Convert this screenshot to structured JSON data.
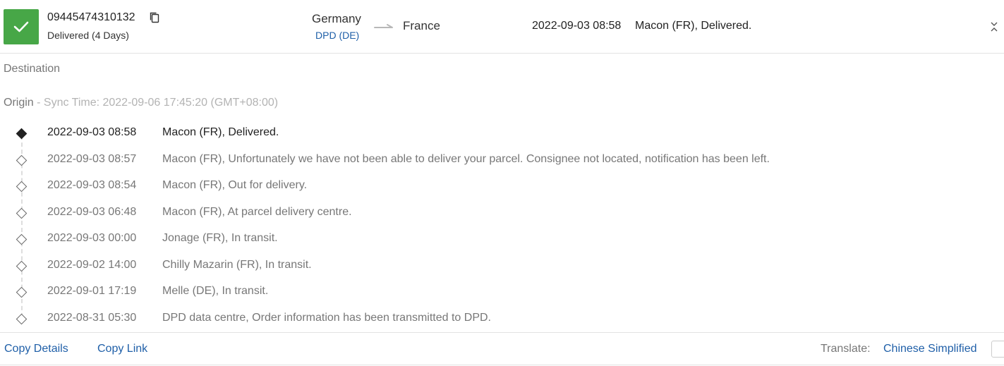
{
  "header": {
    "tracking_number": "09445474310132",
    "status": "Delivered (4 Days)",
    "origin_country": "Germany",
    "carrier": "DPD (DE)",
    "destination_country": "France",
    "latest_event_time": "2022-09-03 08:58",
    "latest_event_desc": "Macon (FR), Delivered.",
    "status_color": "#47a747"
  },
  "sections": {
    "destination_label": "Destination",
    "origin_label": "Origin",
    "sync_text": " - Sync Time: 2022-09-06 17:45:20 (GMT+08:00)"
  },
  "events": [
    {
      "time": "2022-09-03 08:58",
      "desc": "Macon (FR), Delivered."
    },
    {
      "time": "2022-09-03 08:57",
      "desc": "Macon (FR), Unfortunately we have not been able to deliver your parcel. Consignee not located, notification has been left."
    },
    {
      "time": "2022-09-03 08:54",
      "desc": "Macon (FR), Out for delivery."
    },
    {
      "time": "2022-09-03 06:48",
      "desc": "Macon (FR), At parcel delivery centre."
    },
    {
      "time": "2022-09-03 00:00",
      "desc": "Jonage (FR), In transit."
    },
    {
      "time": "2022-09-02 14:00",
      "desc": "Chilly Mazarin (FR), In transit."
    },
    {
      "time": "2022-09-01 17:19",
      "desc": "Melle (DE), In transit."
    },
    {
      "time": "2022-08-31 05:30",
      "desc": "DPD data centre, Order information has been transmitted to DPD."
    }
  ],
  "footer": {
    "copy_details": "Copy Details",
    "copy_link": "Copy Link",
    "translate_label": "Translate:",
    "language": "Chinese Simplified"
  },
  "icons": {
    "status": "check-icon",
    "copy": "copy-icon",
    "route": "arrow-right-icon",
    "expand": "expand-icon"
  }
}
